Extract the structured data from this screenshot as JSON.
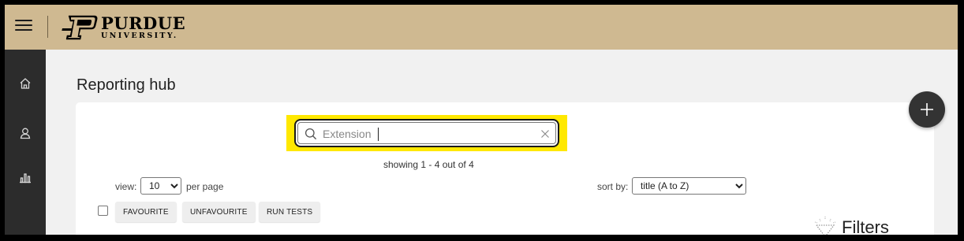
{
  "header": {
    "logo_word": "PURDUE",
    "logo_sub": "UNIVERSITY."
  },
  "sidebar": {
    "items": [
      {
        "icon": "home-icon"
      },
      {
        "icon": "user-icon"
      },
      {
        "icon": "bar-chart-icon"
      }
    ]
  },
  "page": {
    "title": "Reporting hub"
  },
  "search": {
    "value": "Extension",
    "placeholder": ""
  },
  "results": {
    "count_text": "showing 1 - 4 out of 4"
  },
  "pagination": {
    "view_label": "view:",
    "per_page_options": [
      "10"
    ],
    "per_page_label": "per page"
  },
  "sorting": {
    "label": "sort by:",
    "options": [
      "title (A to Z)"
    ]
  },
  "actions": {
    "favourite": "FAVOURITE",
    "unfavourite": "UNFAVOURITE",
    "run_tests": "RUN TESTS"
  },
  "filters": {
    "label": "Filters"
  },
  "colors": {
    "header_gold": "#cfb991",
    "sidebar_dark": "#2c2c2c",
    "highlight_yellow": "#ffe800"
  }
}
